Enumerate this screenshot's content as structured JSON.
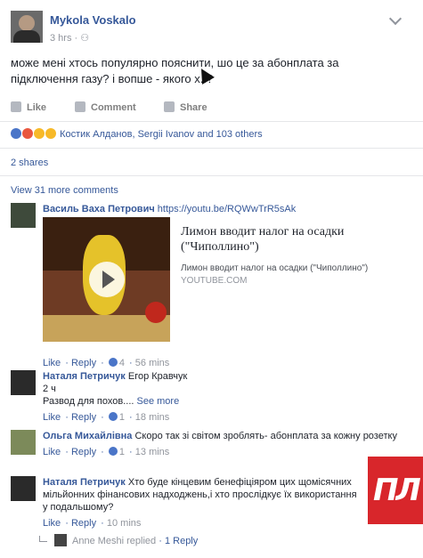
{
  "post": {
    "author": "Mykola Voskalo",
    "time": "3 hrs",
    "privacy_icon": "friends-icon",
    "text": "може мені хтось популярно пояснити, шо це за абонплата за підключення газу? і вопше - якого х..?",
    "actions": {
      "like": "Like",
      "comment": "Comment",
      "share": "Share"
    },
    "reactions": "Костик Алданов, Sergii Ivanov and 103 others",
    "reaction_colors": [
      "#4a75c8",
      "#e9573f",
      "#f7b928",
      "#f7b928"
    ],
    "shares": "2 shares",
    "view_more": "View 31 more comments"
  },
  "comments": [
    {
      "name": "Василь Ваха Петрович",
      "text": "https://youtu.be/RQWwTrR5sAk",
      "preview": {
        "title": "Лимон вводит налог на осадки (\"Чиполлино\")",
        "desc": "Лимон вводит налог на осадки (\"Чиполлино\")",
        "source": "YOUTUBE.COM"
      },
      "like": "Like",
      "reply": "Reply",
      "likes": "4",
      "time": "56 mins"
    },
    {
      "name": "Наталя Петричук",
      "mention": "Егор Кравчук",
      "line2": "2 ч",
      "text": "Развод для похов....",
      "see_more": "See more",
      "like": "Like",
      "reply": "Reply",
      "likes": "1",
      "time": "18 mins"
    },
    {
      "name": "Ольга Михайлівна",
      "text": "Скоро так зі світом зроблять- абонплата за кожну розетку",
      "like": "Like",
      "reply": "Reply",
      "likes": "1",
      "time": "13 mins"
    },
    {
      "name": "Наталя Петричук",
      "text": "Хто буде кінцевим бенефіціяром цих щомісячних мільйонних фінансових надходжень,і хто прослідкує їх використання у подальшому?",
      "like": "Like",
      "reply": "Reply",
      "time": "10 mins"
    }
  ],
  "reply_summary": {
    "name": "Anne Meshi replied",
    "count": "1 Reply"
  },
  "logo_text": "ПЛ"
}
